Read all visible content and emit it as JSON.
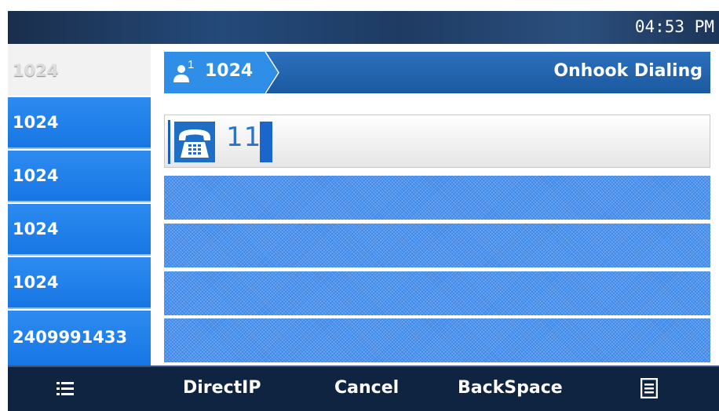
{
  "status_bar": {
    "time": "04:53 PM"
  },
  "lines": [
    {
      "label": "1024",
      "state": "selected"
    },
    {
      "label": "1024",
      "state": "normal"
    },
    {
      "label": "1024",
      "state": "normal"
    },
    {
      "label": "1024",
      "state": "normal"
    },
    {
      "label": "1024",
      "state": "normal"
    },
    {
      "label": "2409991433",
      "state": "normal"
    }
  ],
  "account": {
    "index": "1",
    "number": "1024",
    "mode": "Onhook Dialing",
    "icon": "user-icon"
  },
  "dial": {
    "icon": "phone-keypad-icon",
    "digits": "11"
  },
  "softkeys": {
    "left_icon": "list-icon",
    "items": [
      "DirectIP",
      "Cancel",
      "BackSpace"
    ],
    "right_icon": "menu-icon"
  },
  "colors": {
    "accent": "#1776e4",
    "header": "#1c5a9f",
    "softkey_bg": "#0f2440"
  }
}
